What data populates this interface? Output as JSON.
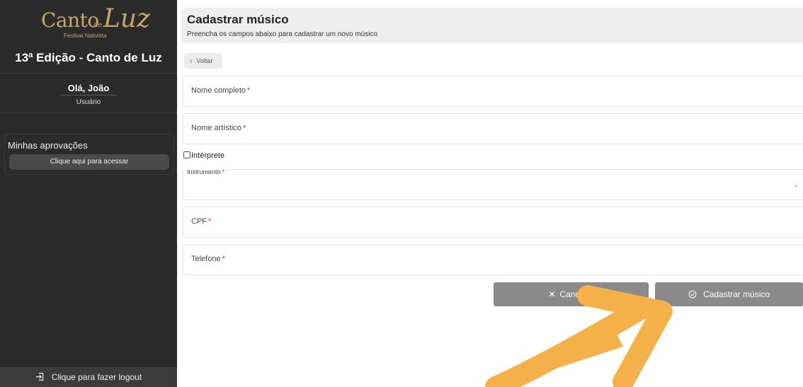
{
  "sidebar": {
    "logo": {
      "main": "Canto",
      "de": "de",
      "luz": "Luz",
      "tagline": "Festival Nativista"
    },
    "edition_title": "13ª Edição - Canto de Luz",
    "greeting": "Olá, João",
    "role": "Usuário",
    "approvals": {
      "title": "Minhas aprovações",
      "button_label": "Clique aqui para acessar"
    },
    "logout_label": "Clique para fazer logout"
  },
  "header": {
    "title": "Cadastrar músico",
    "subtitle": "Preencha os campos abaixo para cadastrar um novo músico"
  },
  "back_label": "Voltar",
  "form": {
    "full_name_label": "Nome completo",
    "artistic_name_label": "Nome artístico",
    "interprete_label": "Intérprete",
    "instrument_label": "Instrumento",
    "cpf_label": "CPF",
    "phone_label": "Telefone",
    "required_mark": "*"
  },
  "buttons": {
    "cancel_label": "Cancelar",
    "submit_label": "Cadastrar músico"
  },
  "colors": {
    "sidebar_bg": "#2b2b2b",
    "logo_gold": "#c9a56a",
    "button_gray": "#8a8a8a",
    "required_red": "#d62020",
    "arrow_orange": "#f5b04a"
  }
}
